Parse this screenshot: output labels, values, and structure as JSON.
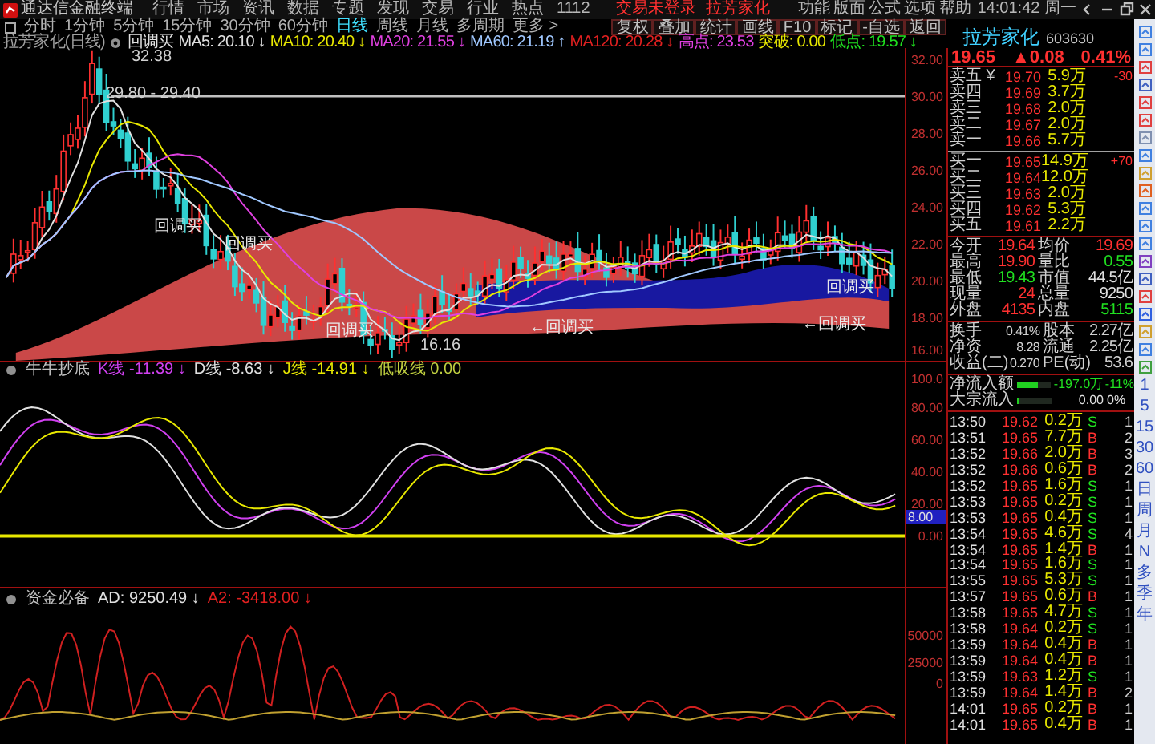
{
  "title_bar": {
    "app": "通达信金融终端",
    "menu": [
      "行情",
      "市场",
      "资讯",
      "数据",
      "专题",
      "发现",
      "交易",
      "行业",
      "热点",
      "1112"
    ],
    "alerts": [
      "交易未登录",
      "拉芳家化"
    ],
    "menu_right": [
      "功能",
      "版面",
      "公式",
      "选项",
      "帮助"
    ],
    "clock": "14:01:42 周一"
  },
  "period_tabs": [
    {
      "label": "分时",
      "selected": false
    },
    {
      "label": "1分钟",
      "selected": false
    },
    {
      "label": "5分钟",
      "selected": false
    },
    {
      "label": "15分钟",
      "selected": false
    },
    {
      "label": "30分钟",
      "selected": false
    },
    {
      "label": "60分钟",
      "selected": false
    },
    {
      "label": "日线",
      "selected": true
    },
    {
      "label": "周线",
      "selected": false
    },
    {
      "label": "月线",
      "selected": false
    },
    {
      "label": "多周期",
      "selected": false
    },
    {
      "label": "更多 >",
      "selected": false
    }
  ],
  "chart_toolbar": [
    "复权",
    "叠加",
    "统计",
    "画线",
    "F10",
    "标记",
    "-自选",
    "返回"
  ],
  "main_chart": {
    "title": "拉芳家化(日线)",
    "indicator": "回调买",
    "legend": [
      {
        "text": "MA5: 20.10",
        "arrow": "↓",
        "color": "#e0e0e0"
      },
      {
        "text": "MA10: 20.40",
        "arrow": "↓",
        "color": "#e8e800"
      },
      {
        "text": "MA20: 21.55",
        "arrow": "↓",
        "color": "#e040e0"
      },
      {
        "text": "MA60: 21.19",
        "arrow": "↑",
        "color": "#a0c8ff"
      },
      {
        "text": "MA120: 20.28",
        "arrow": "↓",
        "color": "#e02020"
      },
      {
        "text": "高点: 23.53",
        "color": "#e040e0"
      },
      {
        "text": "突破: 0.00",
        "color": "#e8e800"
      },
      {
        "text": "低点: 19.57",
        "arrow": "↓",
        "color": "#20e020"
      }
    ],
    "y_labels": [
      "32.00",
      "30.00",
      "28.00",
      "26.00",
      "24.00",
      "22.00",
      "20.00",
      "18.00",
      "16.00"
    ],
    "annotations": [
      "32.38",
      "29.80 - 29.40",
      "回调买",
      "回调买",
      "回调买",
      "←回调买",
      "16.16",
      "回调买",
      "←回调买"
    ]
  },
  "kdj_panel": {
    "title": "牛牛抄底",
    "legend": [
      {
        "text": "K线 -11.39",
        "arrow": "↓",
        "color": "#d040f0"
      },
      {
        "text": "D线 -8.63",
        "arrow": "↓",
        "color": "#e0e0e0"
      },
      {
        "text": "J线 -14.91",
        "arrow": "↓",
        "color": "#e8e800"
      },
      {
        "text": "低吸线 0.00",
        "color": "#c0d040"
      }
    ],
    "y_labels": [
      "100.0",
      "80.00",
      "60.00",
      "40.00",
      "20.00",
      "0.00"
    ],
    "marker": "8.00"
  },
  "ad_panel": {
    "title": "资金必备",
    "legend": [
      {
        "text": "AD: 9250.49",
        "arrow": "↓",
        "color": "#e0e0e0"
      },
      {
        "text": "A2: -3418.00",
        "arrow": "↓",
        "color": "#e02020"
      }
    ],
    "y_labels": [
      "50000",
      "25000",
      "0"
    ]
  },
  "quote": {
    "name": "拉芳家化",
    "code": "603630",
    "price": "19.65",
    "change": "▲0.08",
    "percent": "0.41%",
    "asks": [
      {
        "label": "卖五 ¥",
        "price": "19.70",
        "volume": "5.9万",
        "extra": "-30"
      },
      {
        "label": "卖四",
        "price": "19.69",
        "volume": "3.7万"
      },
      {
        "label": "卖三",
        "price": "19.68",
        "volume": "2.0万"
      },
      {
        "label": "卖二",
        "price": "19.67",
        "volume": "2.0万"
      },
      {
        "label": "卖一",
        "price": "19.66",
        "volume": "5.7万"
      }
    ],
    "bids": [
      {
        "label": "买一",
        "price": "19.65",
        "volume": "14.9万",
        "extra": "+70"
      },
      {
        "label": "买二",
        "price": "19.64",
        "volume": "12.0万"
      },
      {
        "label": "买三",
        "price": "19.63",
        "volume": "2.0万"
      },
      {
        "label": "买四",
        "price": "19.62",
        "volume": "5.3万"
      },
      {
        "label": "买五",
        "price": "19.61",
        "volume": "2.2万"
      }
    ],
    "stats": [
      {
        "label": "今开",
        "value": "19.64",
        "color": "#ff3030"
      },
      {
        "label": "均价",
        "value": "19.69",
        "color": "#ff3030"
      },
      {
        "label": "最高",
        "value": "19.90",
        "color": "#ff3030"
      },
      {
        "label": "量比",
        "value": "0.55",
        "color": "#20e020"
      },
      {
        "label": "最低",
        "value": "19.43",
        "color": "#20e020"
      },
      {
        "label": "市值",
        "value": "44.5亿",
        "color": "#e0e0e0"
      },
      {
        "label": "现量",
        "value": "24",
        "color": "#ff3030"
      },
      {
        "label": "总量",
        "value": "9250",
        "color": "#e0e0e0"
      },
      {
        "label": "外盘",
        "value": "4135",
        "color": "#ff3030"
      },
      {
        "label": "内盘",
        "value": "5115",
        "color": "#20e020"
      }
    ],
    "finance": [
      {
        "label": "换手",
        "value": "0.41%",
        "label2": "股本",
        "value2": "2.27亿"
      },
      {
        "label": "净资",
        "value": "8.28",
        "label2": "流通",
        "value2": "2.25亿"
      },
      {
        "label": "收益(二)",
        "value": "0.270",
        "label2": "PE(动)",
        "value2": "53.6"
      }
    ],
    "flow": [
      {
        "label": "净流入额",
        "level": 0.6,
        "value": "-197.0万",
        "percent": "-11%"
      },
      {
        "label": "大宗流入",
        "level": 0.02,
        "value": "0.00",
        "percent": "0%"
      }
    ],
    "ticks": [
      {
        "time": "13:50",
        "price": "19.62",
        "volume": "0.2万",
        "side": "S",
        "kind": "sell",
        "count": "1"
      },
      {
        "time": "13:51",
        "price": "19.65",
        "volume": "7.7万",
        "side": "B",
        "kind": "buy",
        "count": "2"
      },
      {
        "time": "13:52",
        "price": "19.66",
        "volume": "2.0万",
        "side": "B",
        "kind": "buy",
        "count": "3"
      },
      {
        "time": "13:52",
        "price": "19.66",
        "volume": "0.6万",
        "side": "B",
        "kind": "buy",
        "count": "2"
      },
      {
        "time": "13:52",
        "price": "19.65",
        "volume": "1.6万",
        "side": "S",
        "kind": "sell",
        "count": "1"
      },
      {
        "time": "13:53",
        "price": "19.65",
        "volume": "0.2万",
        "side": "S",
        "kind": "sell",
        "count": "1"
      },
      {
        "time": "13:53",
        "price": "19.65",
        "volume": "0.4万",
        "side": "S",
        "kind": "sell",
        "count": "1"
      },
      {
        "time": "13:54",
        "price": "19.65",
        "volume": "4.6万",
        "side": "S",
        "kind": "sell",
        "count": "4"
      },
      {
        "time": "13:54",
        "price": "19.65",
        "volume": "1.4万",
        "side": "B",
        "kind": "buy",
        "count": "1"
      },
      {
        "time": "13:54",
        "price": "19.65",
        "volume": "1.6万",
        "side": "S",
        "kind": "sell",
        "count": "1"
      },
      {
        "time": "13:55",
        "price": "19.65",
        "volume": "5.3万",
        "side": "S",
        "kind": "sell",
        "count": "1"
      },
      {
        "time": "13:57",
        "price": "19.65",
        "volume": "0.6万",
        "side": "B",
        "kind": "buy",
        "count": "1"
      },
      {
        "time": "13:58",
        "price": "19.65",
        "volume": "4.7万",
        "side": "S",
        "kind": "sell",
        "count": "1"
      },
      {
        "time": "13:58",
        "price": "19.64",
        "volume": "0.2万",
        "side": "S",
        "kind": "sell",
        "count": "1"
      },
      {
        "time": "13:59",
        "price": "19.64",
        "volume": "0.4万",
        "side": "B",
        "kind": "buy",
        "count": "1"
      },
      {
        "time": "13:59",
        "price": "19.64",
        "volume": "0.4万",
        "side": "B",
        "kind": "buy",
        "count": "1"
      },
      {
        "time": "13:59",
        "price": "19.63",
        "volume": "1.2万",
        "side": "S",
        "kind": "sell",
        "count": "1"
      },
      {
        "time": "13:59",
        "price": "19.64",
        "volume": "1.4万",
        "side": "B",
        "kind": "buy",
        "count": "2"
      },
      {
        "time": "14:01",
        "price": "19.65",
        "volume": "0.2万",
        "side": "B",
        "kind": "buy",
        "count": "1"
      },
      {
        "time": "14:01",
        "price": "19.65",
        "volume": "0.4万",
        "side": "B",
        "kind": "buy",
        "count": "1"
      }
    ]
  },
  "side_tools": [
    "1",
    "5",
    "15",
    "30",
    "60",
    "日",
    "周",
    "月",
    "N",
    "多",
    "季",
    "年"
  ]
}
